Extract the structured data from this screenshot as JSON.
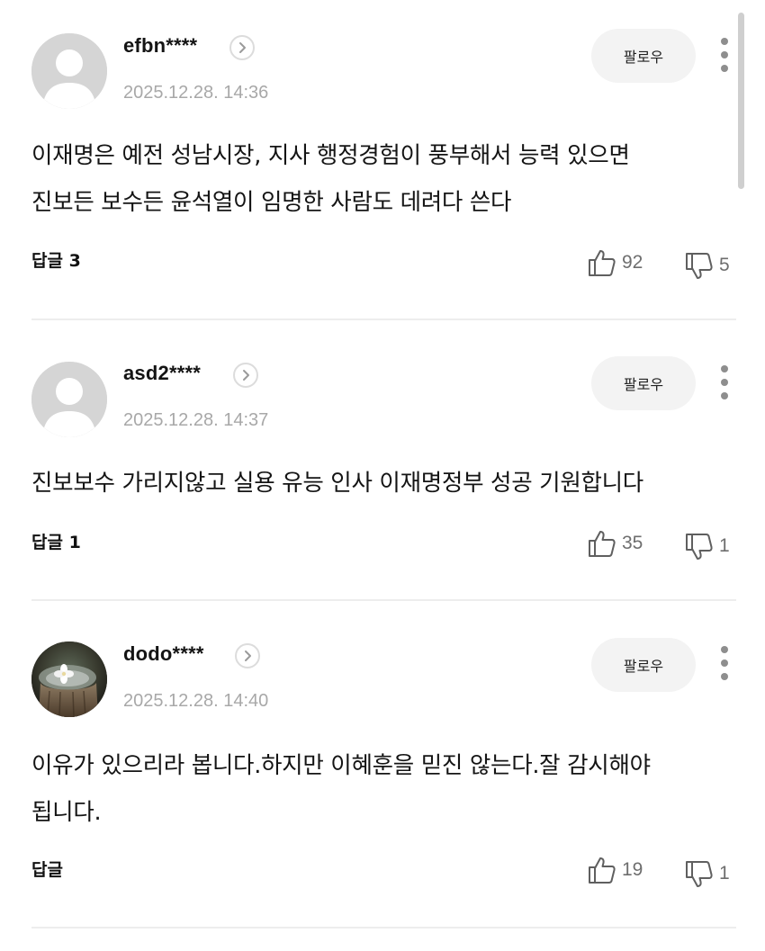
{
  "comments": [
    {
      "username": "efbn****",
      "timestamp": "2025.12.28. 14:36",
      "follow_label": "팔로우",
      "text": "이재명은 예전 성남시장, 지사 행정경험이 풍부해서 능력 있으면\n진보든 보수든 윤석열이 임명한 사람도 데려다 쓴다",
      "reply_label": "답글 3",
      "likes": "92",
      "dislikes": "5",
      "avatar": "default-avatar"
    },
    {
      "username": "asd2****",
      "timestamp": "2025.12.28. 14:37",
      "follow_label": "팔로우",
      "text": "진보보수 가리지않고 실용 유능 인사 이재명정부 성공 기원합니다",
      "reply_label": "답글 1",
      "likes": "35",
      "dislikes": "1",
      "avatar": "default-avatar"
    },
    {
      "username": "dodo****",
      "timestamp": "2025.12.28. 14:40",
      "follow_label": "팔로우",
      "text": "이유가 있으리라 봅니다.하지만 이혜훈을 믿진 않는다.잘 감시해야\n됩니다.",
      "reply_label": "답글",
      "likes": "19",
      "dislikes": "1",
      "avatar": "flower-photo-avatar"
    }
  ],
  "icons": {
    "profile_arrow": "chevron-right-icon",
    "more": "vertical-dots-icon",
    "like": "thumbs-up-icon",
    "dislike": "thumbs-down-icon"
  },
  "colors": {
    "timestamp": "#a8a8a8",
    "count": "#6e6e6e",
    "follow_bg": "#f3f3f3",
    "divider": "#ededed"
  }
}
